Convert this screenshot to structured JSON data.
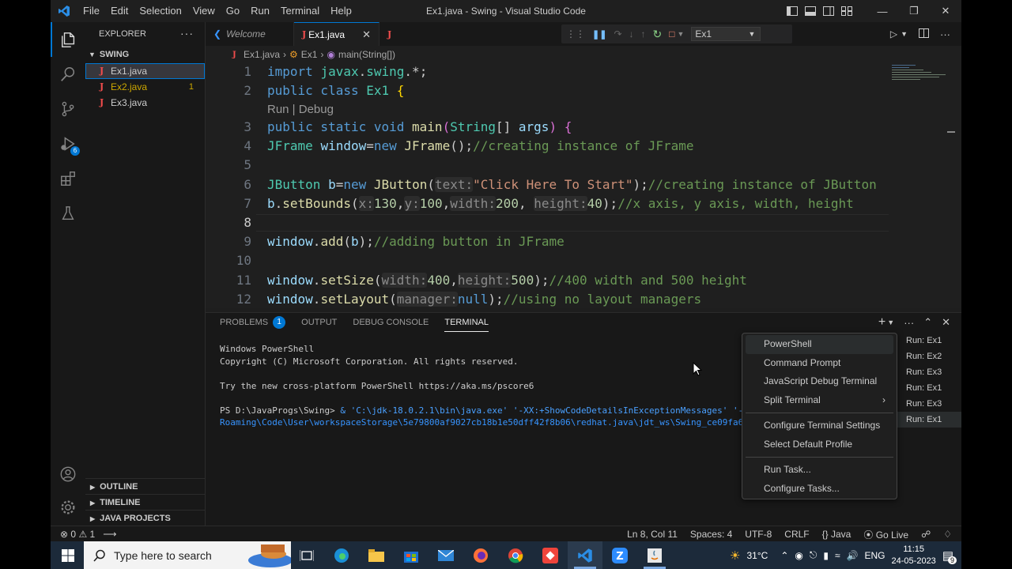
{
  "titlebar": {
    "menus": [
      "File",
      "Edit",
      "Selection",
      "View",
      "Go",
      "Run",
      "Terminal",
      "Help"
    ],
    "title": "Ex1.java - Swing - Visual Studio Code"
  },
  "activity": {
    "debug_badge": "6"
  },
  "sidebar": {
    "header": "EXPLORER",
    "folder": "SWING",
    "files": [
      {
        "name": "Ex1.java",
        "count": ""
      },
      {
        "name": "Ex2.java",
        "count": "1"
      },
      {
        "name": "Ex3.java",
        "count": ""
      }
    ],
    "outline": "OUTLINE",
    "timeline": "TIMELINE",
    "java_projects": "JAVA PROJECTS"
  },
  "tabs": {
    "welcome": "Welcome",
    "ex1": "Ex1.java",
    "run_config": "Ex1"
  },
  "breadcrumb": {
    "file": "Ex1.java",
    "class": "Ex1",
    "method": "main(String[])"
  },
  "editor": {
    "line_numbers": [
      "1",
      "2",
      "3",
      "4",
      "5",
      "6",
      "7",
      "8",
      "9",
      "10",
      "11",
      "12"
    ],
    "codelens": "Run | Debug",
    "current_line": "8"
  },
  "panel": {
    "tabs": [
      "PROBLEMS",
      "OUTPUT",
      "DEBUG CONSOLE",
      "TERMINAL"
    ],
    "problems_count": "1",
    "terminal_lines": {
      "l1": "Windows PowerShell",
      "l2": "Copyright (C) Microsoft Corporation. All rights reserved.",
      "l3": "Try the new cross-platform PowerShell https://aka.ms/pscore6",
      "prompt": "PS D:\\JavaProgs\\Swing> ",
      "cmd1": "& 'C:\\jdk-18.0.2.1\\bin\\java.exe' '-XX:+ShowCodeDetailsInExceptionMessages' '-cp'",
      "cmd2": "Roaming\\Code\\User\\workspaceStorage\\5e79800af9027cb18b1e50dff42f8b06\\redhat.java\\jdt_ws\\Swing_ce09fa6d\\bin"
    },
    "terminals": [
      "Run: Ex1",
      "Run: Ex2",
      "Run: Ex3",
      "Run: Ex1",
      "Run: Ex3",
      "Run: Ex1"
    ]
  },
  "menu": {
    "items_a": [
      "PowerShell",
      "Command Prompt",
      "JavaScript Debug Terminal",
      "Split Terminal"
    ],
    "items_b": [
      "Configure Terminal Settings",
      "Select Default Profile"
    ],
    "items_c": [
      "Run Task...",
      "Configure Tasks..."
    ]
  },
  "statusbar": {
    "errors": "0",
    "warnings": "1",
    "position": "Ln 8, Col 11",
    "spaces": "Spaces: 4",
    "encoding": "UTF-8",
    "eol": "CRLF",
    "language": "Java",
    "golive": "Go Live"
  },
  "taskbar": {
    "search_placeholder": "Type here to search",
    "weather": "31°C",
    "lang": "ENG",
    "time": "11:15",
    "date": "24-05-2023",
    "notif": "9"
  },
  "colors": {
    "accent": "#0078d4",
    "error": "#f14c4c",
    "warning": "#cca700"
  }
}
